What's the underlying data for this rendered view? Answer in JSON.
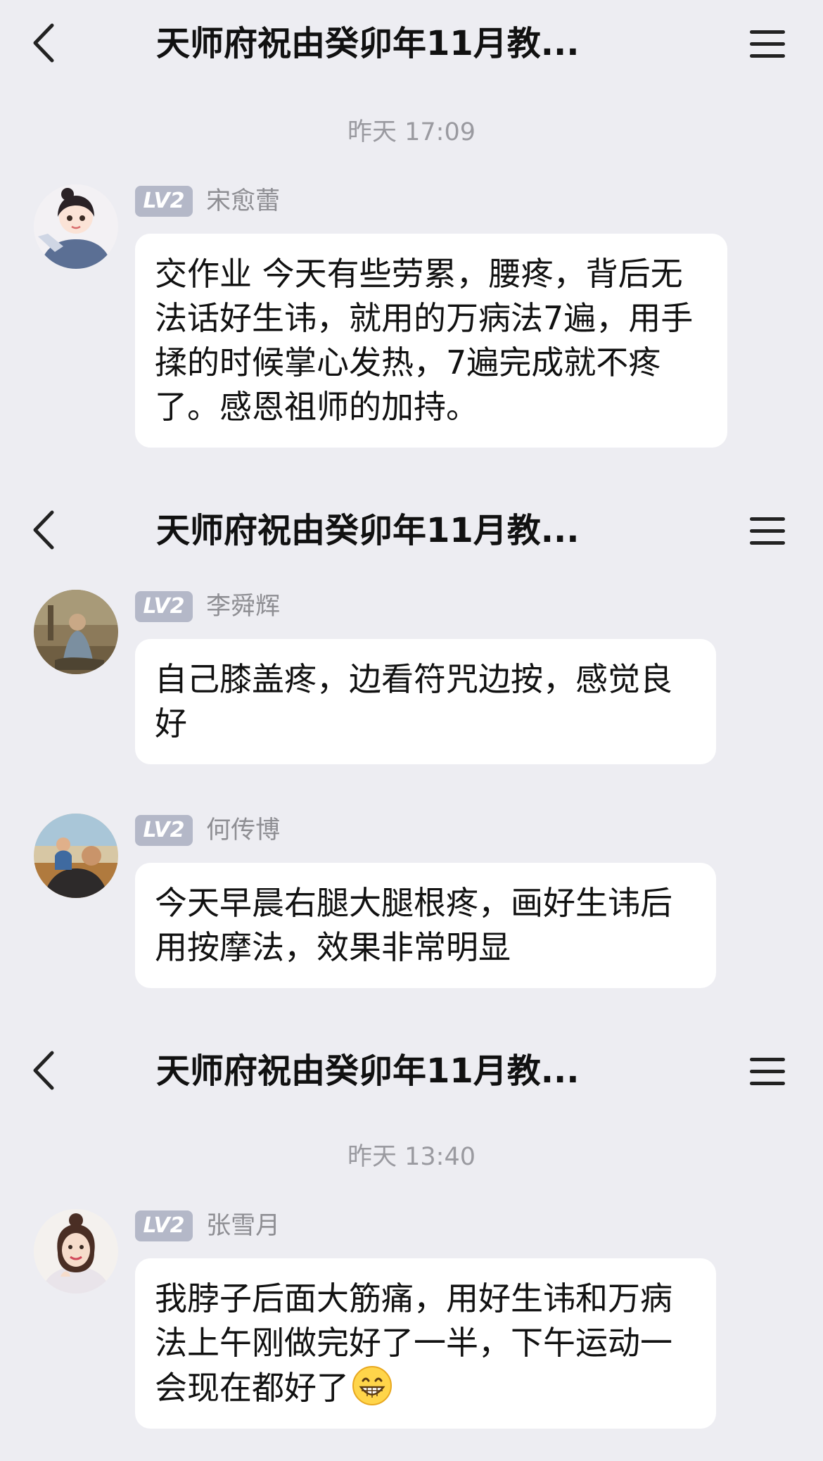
{
  "app": {
    "chat_title": "天师府祝由癸卯年11月教..."
  },
  "colors": {
    "background": "#ededf2",
    "bubble": "#ffffff",
    "level_badge": "#b4b8c8",
    "timestamp_text": "#9a9aa0",
    "name_text": "#8e8e93"
  },
  "icons": {
    "back": "chevron-left-icon",
    "menu": "hamburger-menu-icon",
    "emoji": "grinning-face-emoji"
  },
  "screens": [
    {
      "header": {
        "title": "天师府祝由癸卯年11月教..."
      },
      "timestamp": "昨天 17:09",
      "messages": [
        {
          "level": "LV2",
          "sender": "宋愈蕾",
          "text": "交作业 今天有些劳累，腰疼，背后无法话好生讳，就用的万病法7遍，用手揉的时候掌心发热，7遍完成就不疼了。感恩祖师的加持。"
        }
      ]
    },
    {
      "header": {
        "title": "天师府祝由癸卯年11月教..."
      },
      "messages": [
        {
          "level": "LV2",
          "sender": "李舜辉",
          "text": "自己膝盖疼，边看符咒边按，感觉良好"
        },
        {
          "level": "LV2",
          "sender": "何传博",
          "text": "今天早晨右腿大腿根疼，画好生讳后用按摩法，效果非常明显"
        }
      ]
    },
    {
      "header": {
        "title": "天师府祝由癸卯年11月教..."
      },
      "timestamp": "昨天 13:40",
      "messages": [
        {
          "level": "LV2",
          "sender": "张雪月",
          "text": "我脖子后面大筋痛，用好生讳和万病法上午刚做完好了一半，下午运动一会现在都好了"
        }
      ]
    }
  ]
}
